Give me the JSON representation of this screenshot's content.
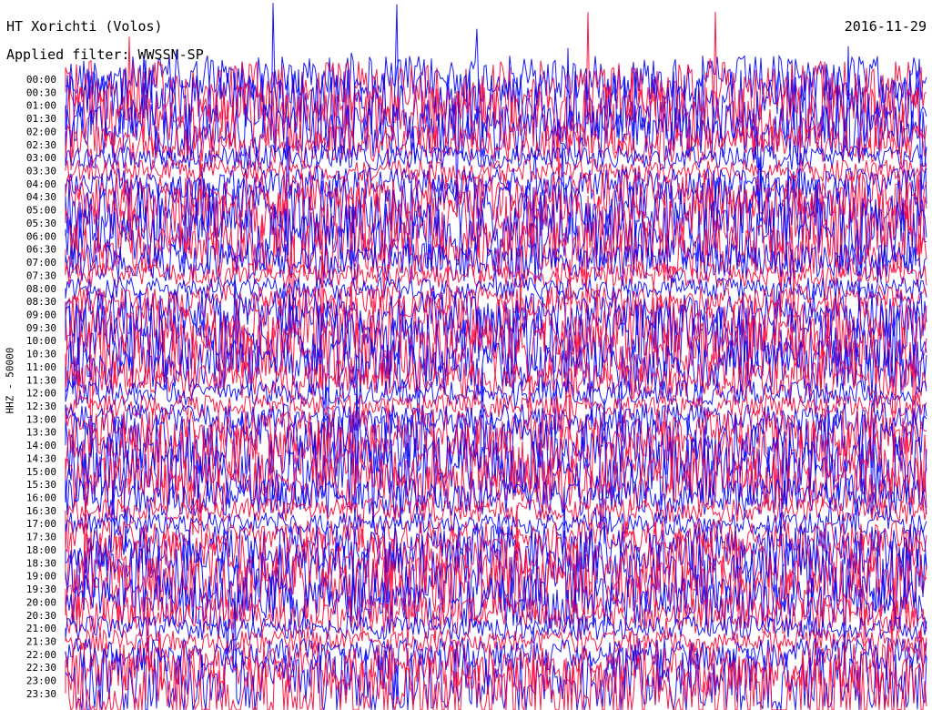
{
  "header": {
    "station": "HT Xorichti (Volos)",
    "date": "2016-11-29",
    "filter": "Applied filter: WWSSN-SP"
  },
  "colors": {
    "trace_a": "#0000ff",
    "trace_b": "#ff0033",
    "background": "#ffffff"
  },
  "chart_data": {
    "type": "line",
    "title": "HT Xorichti (Volos)",
    "ylabel": "HHZ - 50000",
    "xlabel": "",
    "grid": false,
    "row_labels": [
      "00:00",
      "00:30",
      "01:00",
      "01:30",
      "02:00",
      "02:30",
      "03:00",
      "03:30",
      "04:00",
      "04:30",
      "05:00",
      "05:30",
      "06:00",
      "06:30",
      "07:00",
      "07:30",
      "08:00",
      "08:30",
      "09:00",
      "09:30",
      "10:00",
      "10:30",
      "11:00",
      "11:30",
      "12:00",
      "12:30",
      "13:00",
      "13:30",
      "14:00",
      "14:30",
      "15:00",
      "15:30",
      "16:00",
      "16:30",
      "17:00",
      "17:30",
      "18:00",
      "18:30",
      "19:00",
      "19:30",
      "20:00",
      "20:30",
      "21:00",
      "21:30",
      "22:00",
      "22:30",
      "23:00",
      "23:30"
    ],
    "trace_color_cycle": [
      "trace_a",
      "trace_b"
    ]
  }
}
